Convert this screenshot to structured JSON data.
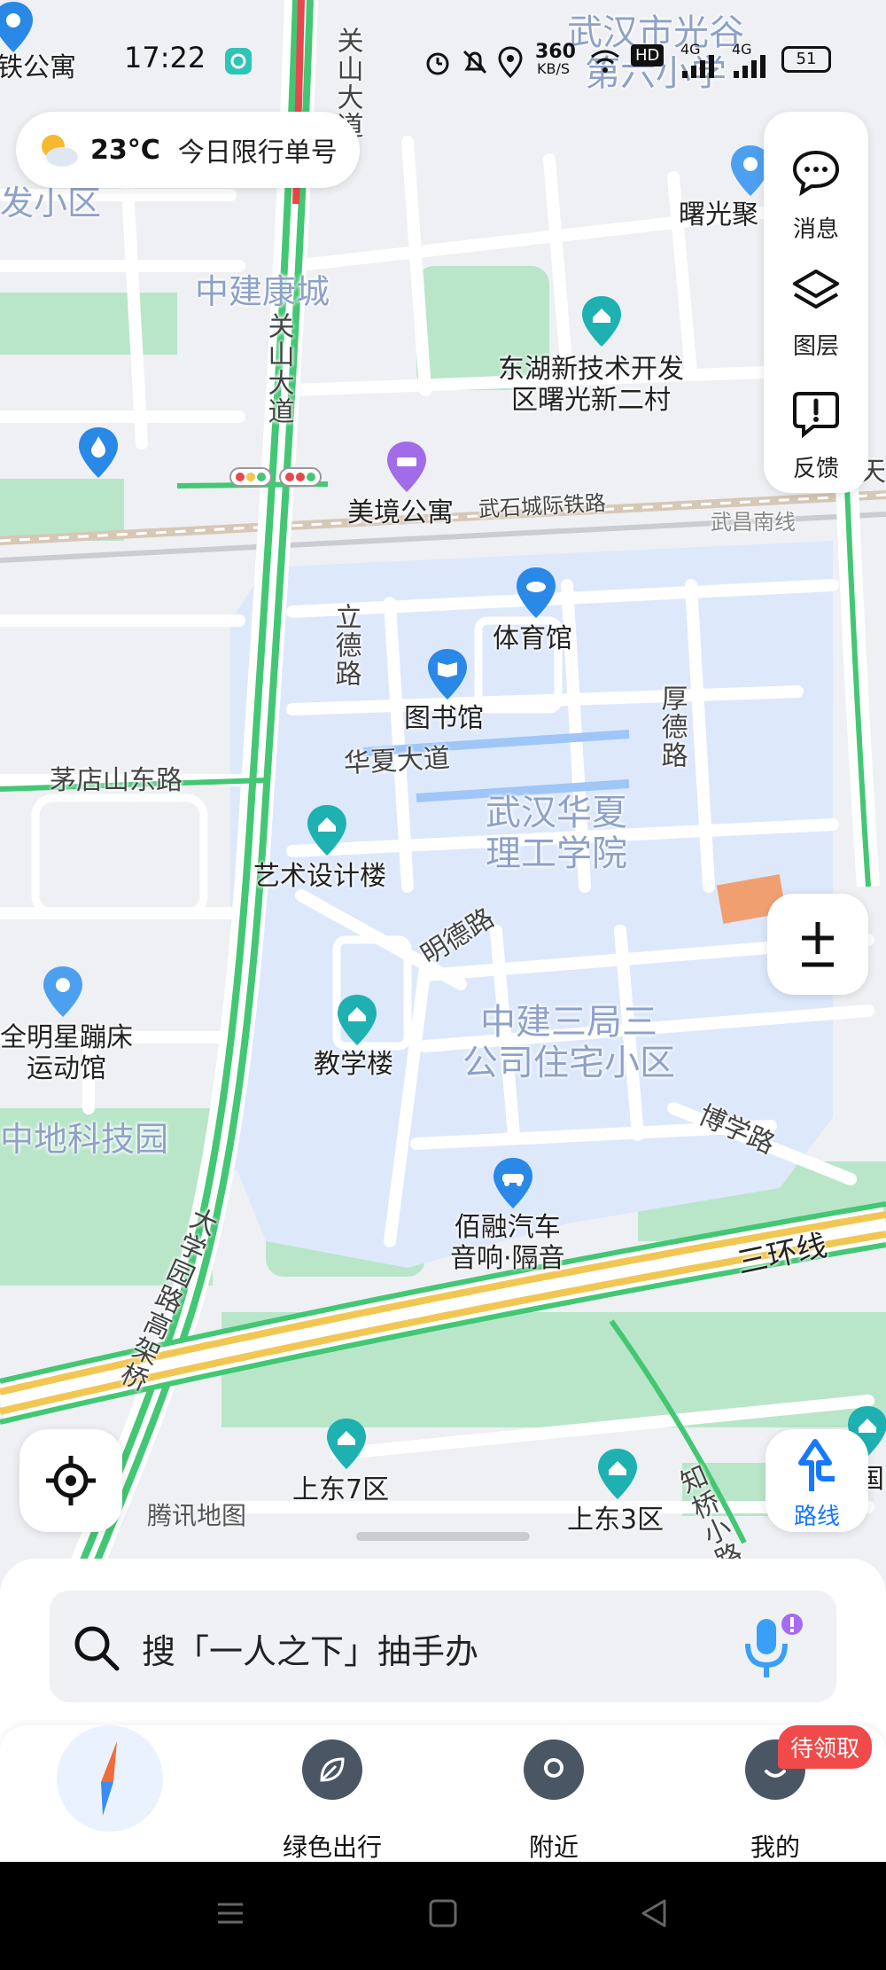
{
  "status_bar": {
    "time": "17:22",
    "net_speed": "360\nKB/S",
    "net_speed_top": "360",
    "net_speed_bottom": "KB/S",
    "battery": "51",
    "sim1": "4G",
    "sim2": "4G",
    "hd": "HD"
  },
  "weather": {
    "temp": "23°C",
    "restriction": "今日限行单号"
  },
  "right_panel": {
    "messages": "消息",
    "layers": "图层",
    "feedback": "反馈"
  },
  "map": {
    "area_labels": {
      "top_school": "武汉市光谷\n第六小学",
      "fa_xiaoqu": "发小区",
      "zhongjian_kangcheng": "中建康城",
      "wuhan_huaxia": "武汉华夏\n理工学院",
      "zhongjian_sanju": "中建三局三\n公司住宅小区",
      "zhongdi_keji": "中地科技园"
    },
    "road_labels": {
      "guanshan_top": "关山大道",
      "guanshan_mid": "关山大道",
      "wushi_railway": "武石城际铁路",
      "wuchang_south": "武昌南线",
      "lide_road": "立德路",
      "houde_road": "厚德路",
      "huaxia_avenue": "华夏大道",
      "maodian_road": "茅店山东路",
      "mingde_road": "明德路",
      "boxue_road": "博学路",
      "third_ring": "三环线",
      "daxueyuan": "大学园路高架桥",
      "zhiqiao": "知桥小路",
      "tian_road": "天"
    },
    "poi_labels": {
      "tie_apartment": "铁公寓",
      "shuguang": "曙光聚",
      "donghu": "东湖新技术开发\n区曙光新二村",
      "meijing": "美境公寓",
      "gym": "体育馆",
      "library": "图书馆",
      "art_building": "艺术设计楼",
      "trampoline": "全明星蹦床\n运动馆",
      "teaching": "教学楼",
      "bairong": "佰融汽车\n音响·隔音",
      "shangdong7": "上东7区",
      "shangdong3": "上东3区",
      "guo": "国"
    },
    "watermark": "腾讯地图",
    "colors": {
      "background": "#eef0f3",
      "campus": "#dde8fb",
      "green": "#b9e6c9",
      "road_green": "#43c774",
      "road_red": "#e8474c",
      "pin_blue": "#2a88e6",
      "pin_teal": "#1fb1b2",
      "pin_purple": "#a26ce8"
    }
  },
  "route_button": {
    "label": "路线"
  },
  "search": {
    "placeholder": "搜「一人之下」抽手办"
  },
  "bottom_nav": {
    "items": [
      {
        "label": ""
      },
      {
        "label": "绿色出行"
      },
      {
        "label": "附近"
      },
      {
        "label": "我的"
      }
    ],
    "badge": "待领取"
  }
}
